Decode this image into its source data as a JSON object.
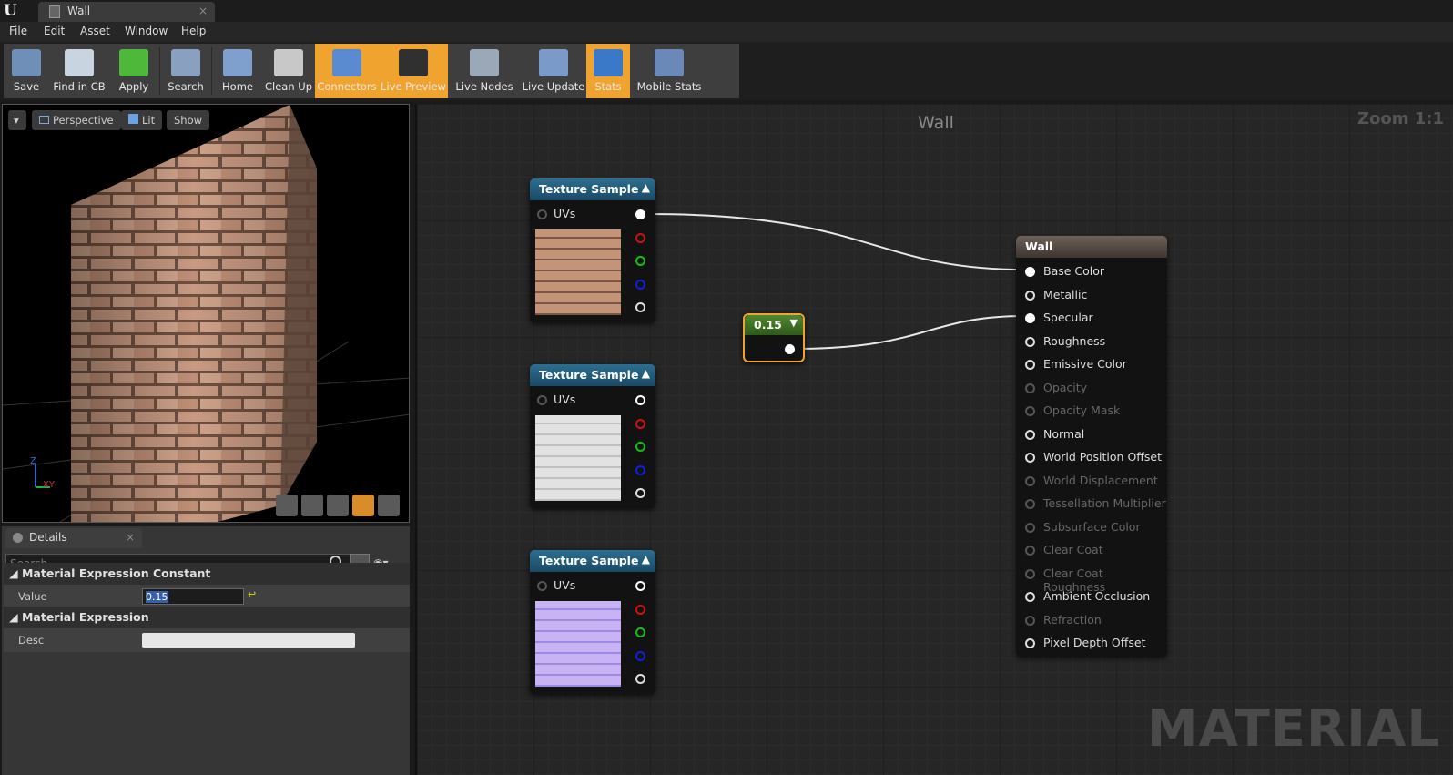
{
  "window": {
    "tab_title": "Wall"
  },
  "menu": [
    "File",
    "Edit",
    "Asset",
    "Window",
    "Help"
  ],
  "toolbar": [
    {
      "label": "Save",
      "icon": "save-icon",
      "active": false
    },
    {
      "label": "Find in CB",
      "icon": "find-in-cb-icon",
      "active": false
    },
    {
      "label": "Apply",
      "icon": "apply-check-icon",
      "active": false
    },
    {
      "label": "Search",
      "icon": "binoculars-icon",
      "active": false
    },
    {
      "label": "Home",
      "icon": "home-icon",
      "active": false
    },
    {
      "label": "Clean Up",
      "icon": "broom-icon",
      "active": false
    },
    {
      "label": "Connectors",
      "icon": "connectors-icon",
      "active": true
    },
    {
      "label": "Live Preview",
      "icon": "live-preview-icon",
      "active": true
    },
    {
      "label": "Live Nodes",
      "icon": "live-nodes-icon",
      "active": false
    },
    {
      "label": "Live Update",
      "icon": "live-update-icon",
      "active": false
    },
    {
      "label": "Stats",
      "icon": "stats-icon",
      "active": true
    },
    {
      "label": "Mobile Stats",
      "icon": "mobile-stats-icon",
      "active": false
    }
  ],
  "viewport": {
    "view_mode": "Perspective",
    "lighting": "Lit",
    "show": "Show",
    "axis_z": "Z",
    "axis_xy": "XY"
  },
  "details": {
    "tab_label": "Details",
    "search_placeholder": "Search",
    "cat1": "Material Expression Constant",
    "value_label": "Value",
    "value": "0.15",
    "cat2": "Material Expression",
    "desc_label": "Desc",
    "desc_value": ""
  },
  "graph": {
    "title": "Wall",
    "zoom": "Zoom 1:1",
    "watermark": "MATERIAL",
    "texture_nodes": [
      {
        "title": "Texture Sample",
        "input": "UVs",
        "texture": "brick-diffuse"
      },
      {
        "title": "Texture Sample",
        "input": "UVs",
        "texture": "brick-specular"
      },
      {
        "title": "Texture Sample",
        "input": "UVs",
        "texture": "brick-normal"
      }
    ],
    "constant_node": {
      "title": "0.15"
    },
    "material_node": {
      "title": "Wall",
      "pins": [
        {
          "label": "Base Color",
          "enabled": true,
          "connected": true
        },
        {
          "label": "Metallic",
          "enabled": true,
          "connected": false
        },
        {
          "label": "Specular",
          "enabled": true,
          "connected": true
        },
        {
          "label": "Roughness",
          "enabled": true,
          "connected": false
        },
        {
          "label": "Emissive Color",
          "enabled": true,
          "connected": false
        },
        {
          "label": "Opacity",
          "enabled": false,
          "connected": false
        },
        {
          "label": "Opacity Mask",
          "enabled": false,
          "connected": false
        },
        {
          "label": "Normal",
          "enabled": true,
          "connected": false
        },
        {
          "label": "World Position Offset",
          "enabled": true,
          "connected": false
        },
        {
          "label": "World Displacement",
          "enabled": false,
          "connected": false
        },
        {
          "label": "Tessellation Multiplier",
          "enabled": false,
          "connected": false
        },
        {
          "label": "Subsurface Color",
          "enabled": false,
          "connected": false
        },
        {
          "label": "Clear Coat",
          "enabled": false,
          "connected": false
        },
        {
          "label": "Clear Coat Roughness",
          "enabled": false,
          "connected": false
        },
        {
          "label": "Ambient Occlusion",
          "enabled": true,
          "connected": false
        },
        {
          "label": "Refraction",
          "enabled": false,
          "connected": false
        },
        {
          "label": "Pixel Depth Offset",
          "enabled": true,
          "connected": false
        }
      ]
    }
  },
  "colors": {
    "accent": "#f0a32e",
    "texture_header": "#1f5a7a",
    "constant_header": "#3d6b24",
    "material_header": "#5a4f45",
    "pin_red": "#d01010",
    "pin_green": "#10c010",
    "pin_blue": "#1020e0"
  }
}
